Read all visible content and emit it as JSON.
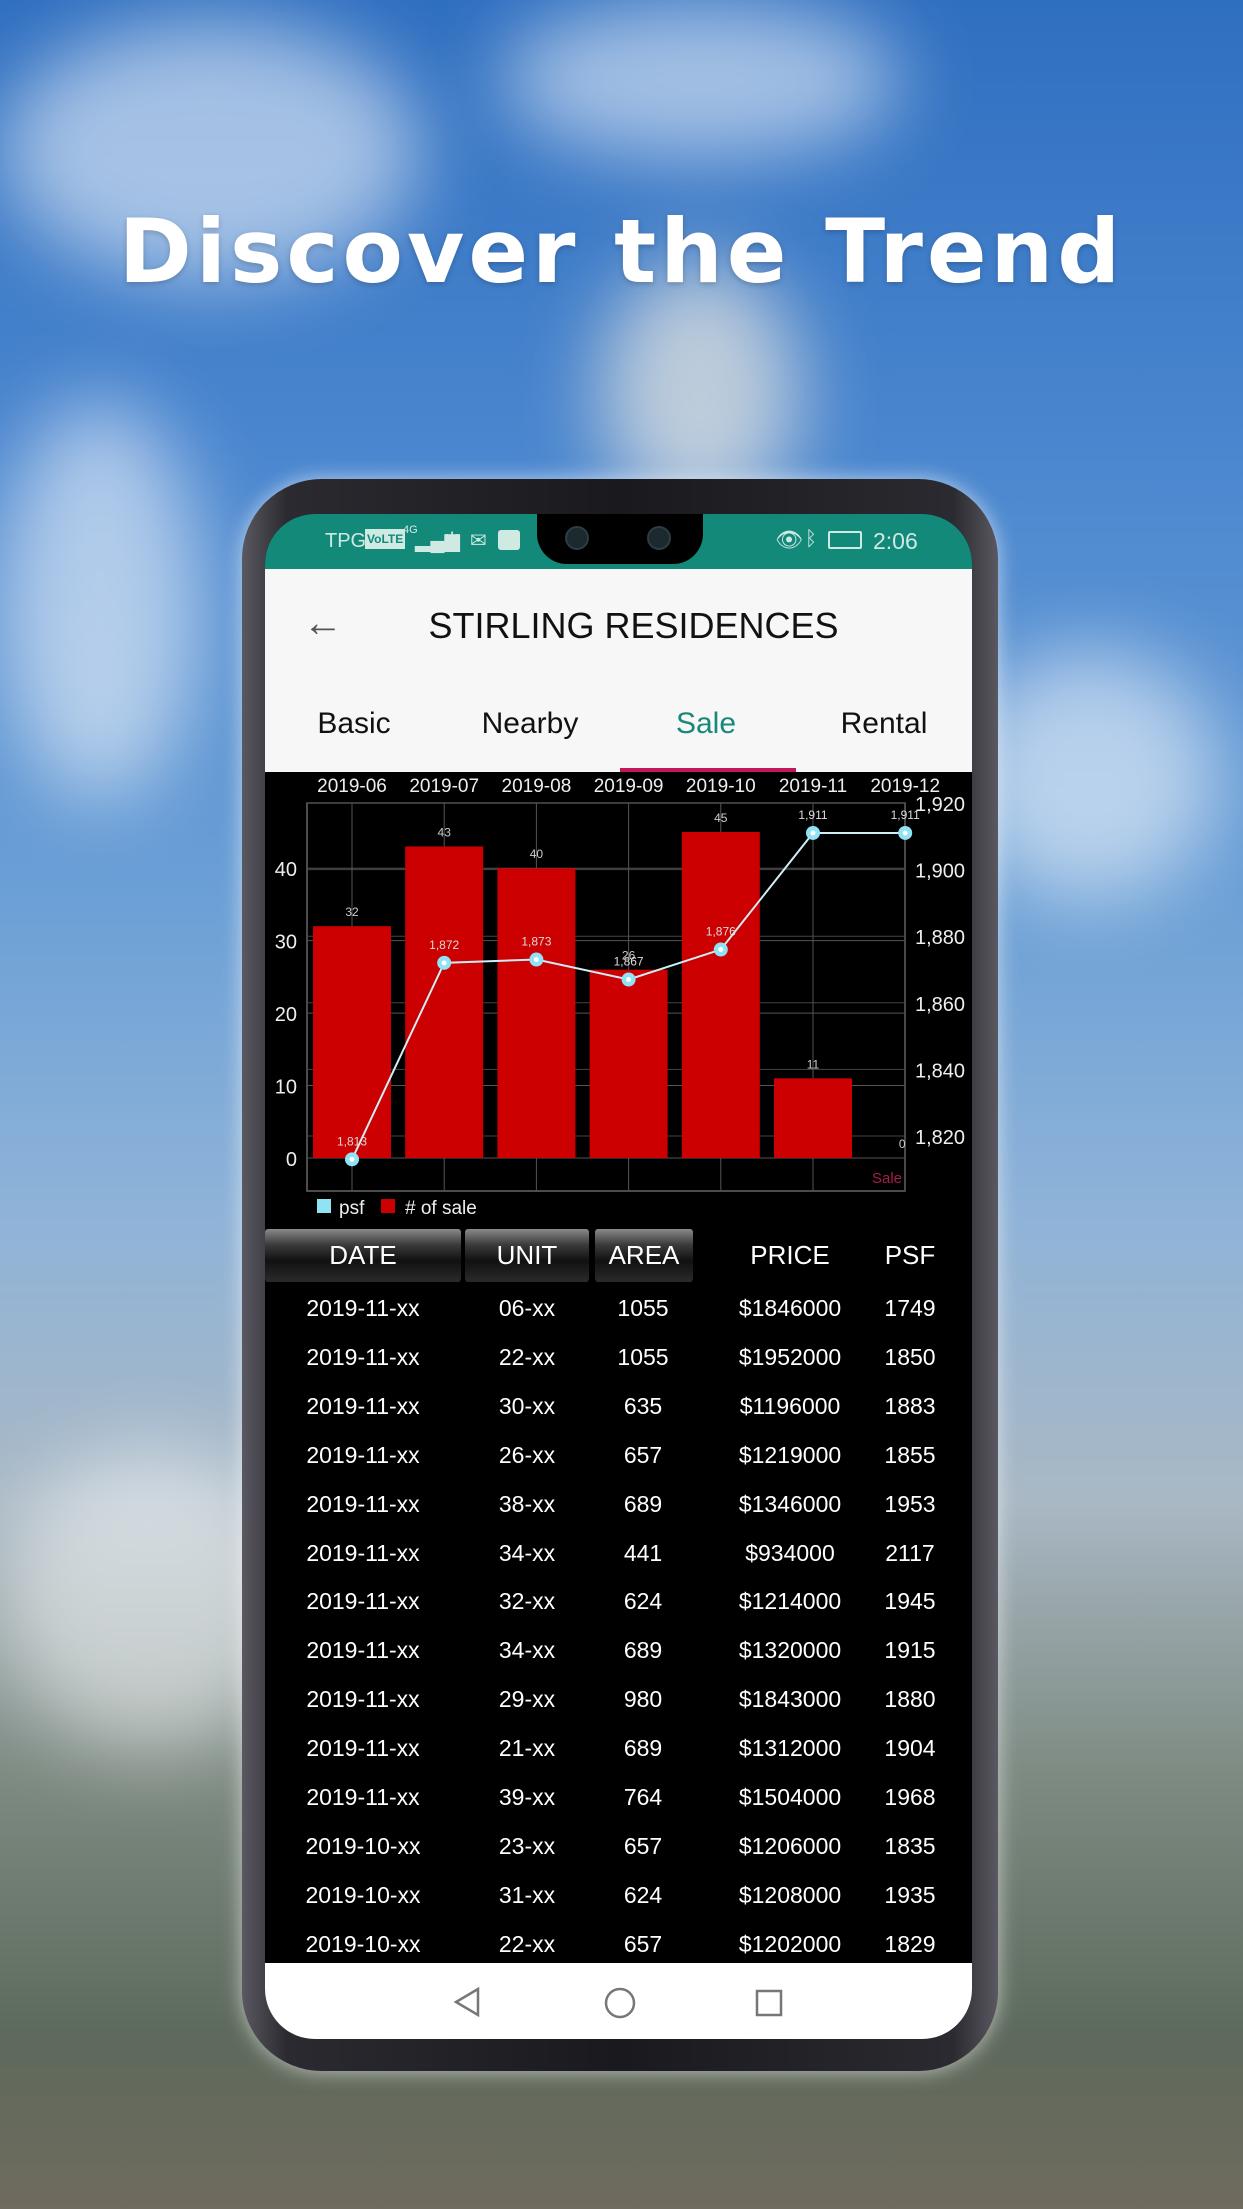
{
  "headline": "Discover the Trend",
  "status": {
    "carrier": "TPG",
    "volte": "VoLTE",
    "network": "4G",
    "time": "2:06"
  },
  "header": {
    "title": "STIRLING RESIDENCES",
    "back_icon": "arrow-left-icon"
  },
  "tabs": [
    {
      "label": "Basic"
    },
    {
      "label": "Nearby"
    },
    {
      "label": "Sale",
      "active": true
    },
    {
      "label": "Rental"
    }
  ],
  "colors": {
    "accent": "#17887a",
    "tab_indicator": "#c2185b",
    "bar": "#cc0000",
    "line": "#8fe3f5",
    "status_bar": "#13897a"
  },
  "chart_data": {
    "type": "bar+line",
    "categories": [
      "2019-06",
      "2019-07",
      "2019-08",
      "2019-09",
      "2019-10",
      "2019-11",
      "2019-12"
    ],
    "series": [
      {
        "name": "# of sale",
        "type": "bar",
        "axis": "left",
        "values": [
          32,
          43,
          40,
          26,
          45,
          11,
          0
        ]
      },
      {
        "name": "psf",
        "type": "line",
        "axis": "right",
        "values": [
          1813,
          1872,
          1873,
          1867,
          1876,
          1911,
          1911
        ],
        "labels": [
          "1,813",
          "1,872",
          "1,873",
          "1,867",
          "1,876",
          "1,911",
          "1,911"
        ]
      }
    ],
    "left_ticks": [
      "0",
      "10",
      "20",
      "30",
      "40"
    ],
    "right_ticks": [
      "1,820",
      "1,840",
      "1,860",
      "1,880",
      "1,900",
      "1,920"
    ],
    "left_range": [
      0,
      49
    ],
    "right_range": [
      1813.4,
      1920
    ],
    "description_label": "Sale",
    "legend": [
      {
        "name": "psf",
        "color": "#8fe3f5"
      },
      {
        "name": "# of sale",
        "color": "#cc0000"
      }
    ],
    "legend_position": "bottom-left",
    "grid": true
  },
  "table": {
    "columns": [
      "DATE",
      "UNIT",
      "AREA",
      "PRICE",
      "PSF"
    ],
    "rows": [
      [
        "2019-11-xx",
        "06-xx",
        "1055",
        "$1846000",
        "1749"
      ],
      [
        "2019-11-xx",
        "22-xx",
        "1055",
        "$1952000",
        "1850"
      ],
      [
        "2019-11-xx",
        "30-xx",
        "635",
        "$1196000",
        "1883"
      ],
      [
        "2019-11-xx",
        "26-xx",
        "657",
        "$1219000",
        "1855"
      ],
      [
        "2019-11-xx",
        "38-xx",
        "689",
        "$1346000",
        "1953"
      ],
      [
        "2019-11-xx",
        "34-xx",
        "441",
        "$934000",
        "2117"
      ],
      [
        "2019-11-xx",
        "32-xx",
        "624",
        "$1214000",
        "1945"
      ],
      [
        "2019-11-xx",
        "34-xx",
        "689",
        "$1320000",
        "1915"
      ],
      [
        "2019-11-xx",
        "29-xx",
        "980",
        "$1843000",
        "1880"
      ],
      [
        "2019-11-xx",
        "21-xx",
        "689",
        "$1312000",
        "1904"
      ],
      [
        "2019-11-xx",
        "39-xx",
        "764",
        "$1504000",
        "1968"
      ],
      [
        "2019-10-xx",
        "23-xx",
        "657",
        "$1206000",
        "1835"
      ],
      [
        "2019-10-xx",
        "31-xx",
        "624",
        "$1208000",
        "1935"
      ],
      [
        "2019-10-xx",
        "22-xx",
        "657",
        "$1202000",
        "1829"
      ]
    ]
  },
  "navbar": {
    "back": "triangle-back-icon",
    "home": "circle-home-icon",
    "recents": "square-recents-icon"
  }
}
